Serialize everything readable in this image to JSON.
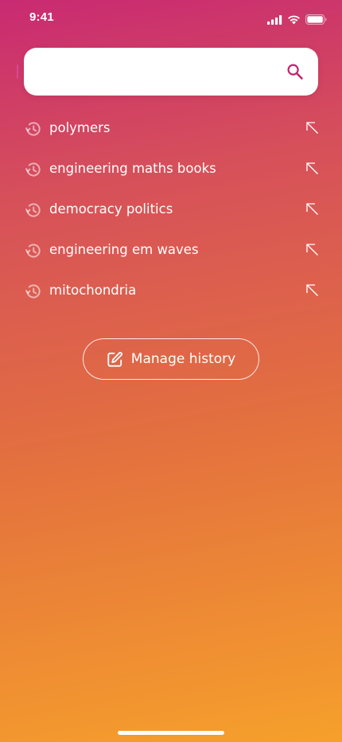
{
  "status_bar": {
    "time": "9:41",
    "icons": [
      "cellular-signal-icon",
      "wifi-icon",
      "battery-icon"
    ]
  },
  "search": {
    "placeholder": "",
    "value": "",
    "icon": "search-icon"
  },
  "history": {
    "items": [
      {
        "label": "polymers",
        "icon": "history-icon",
        "action_icon": "arrow-up-left-icon"
      },
      {
        "label": "engineering maths books",
        "icon": "history-icon",
        "action_icon": "arrow-up-left-icon"
      },
      {
        "label": "democracy politics",
        "icon": "history-icon",
        "action_icon": "arrow-up-left-icon"
      },
      {
        "label": "engineering em waves",
        "icon": "history-icon",
        "action_icon": "arrow-up-left-icon"
      },
      {
        "label": "mitochondria",
        "icon": "history-icon",
        "action_icon": "arrow-up-left-icon"
      }
    ],
    "manage_button": {
      "label": "Manage history",
      "icon": "edit-icon"
    }
  },
  "colors": {
    "gradient_top": "#c92a72",
    "gradient_mid": "#e3703f",
    "gradient_bottom": "#f6a02b",
    "accent": "#c2256e",
    "text": "#ffffff"
  }
}
